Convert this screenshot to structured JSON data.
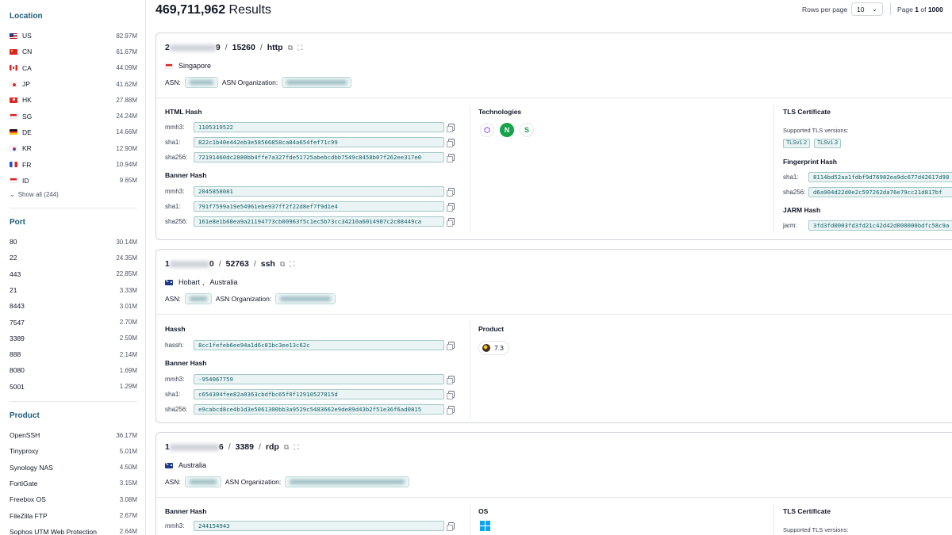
{
  "header": {
    "result_count": "469,711,962",
    "results_label": "Results",
    "rows_per_page_label": "Rows per page",
    "rows_per_page_value": "10",
    "page_label": "Page",
    "page_current": "1",
    "page_of": "of",
    "page_total": "1000"
  },
  "sidebar": {
    "location": {
      "title": "Location",
      "items": [
        {
          "name": "US",
          "count": "82.97M",
          "flag": "f-us"
        },
        {
          "name": "CN",
          "count": "61.67M",
          "flag": "f-cn"
        },
        {
          "name": "CA",
          "count": "44.09M",
          "flag": "f-ca"
        },
        {
          "name": "JP",
          "count": "41.62M",
          "flag": "f-jp"
        },
        {
          "name": "HK",
          "count": "27.88M",
          "flag": "f-hk"
        },
        {
          "name": "SG",
          "count": "24.24M",
          "flag": "f-sg"
        },
        {
          "name": "DE",
          "count": "14.66M",
          "flag": "f-de"
        },
        {
          "name": "KR",
          "count": "12.90M",
          "flag": "f-kr"
        },
        {
          "name": "FR",
          "count": "10.94M",
          "flag": "f-fr"
        },
        {
          "name": "ID",
          "count": "9.65M",
          "flag": "f-id"
        }
      ],
      "show_all": "Show all (244)"
    },
    "port": {
      "title": "Port",
      "items": [
        {
          "name": "80",
          "count": "30.14M"
        },
        {
          "name": "22",
          "count": "24.35M"
        },
        {
          "name": "443",
          "count": "22.85M"
        },
        {
          "name": "21",
          "count": "3.33M"
        },
        {
          "name": "8443",
          "count": "3.01M"
        },
        {
          "name": "7547",
          "count": "2.70M"
        },
        {
          "name": "3389",
          "count": "2.59M"
        },
        {
          "name": "888",
          "count": "2.14M"
        },
        {
          "name": "8080",
          "count": "1.69M"
        },
        {
          "name": "5001",
          "count": "1.29M"
        }
      ]
    },
    "product": {
      "title": "Product",
      "items": [
        {
          "name": "OpenSSH",
          "count": "36.17M"
        },
        {
          "name": "Tinyproxy",
          "count": "5.01M"
        },
        {
          "name": "Synology NAS",
          "count": "4.50M"
        },
        {
          "name": "FortiGate",
          "count": "3.15M"
        },
        {
          "name": "Freebox OS",
          "count": "3.08M"
        },
        {
          "name": "FileZilla FTP",
          "count": "2.67M"
        },
        {
          "name": "Sophos UTM Web Protection",
          "count": "2.64M"
        }
      ]
    }
  },
  "cards": [
    {
      "ip_first": "2",
      "ip_last": "9",
      "port": "15260",
      "protocol": "http",
      "location": "Singapore",
      "asn_label": "ASN:",
      "asn_org_label": "ASN Organization:",
      "html_hash": {
        "title": "HTML Hash",
        "mmh3_label": "mmh3:",
        "mmh3": "1105319522",
        "sha1_label": "sha1:",
        "sha1": "822c1b40e442eb3e58566858ca84a654fef71c99",
        "sha256_label": "sha256:",
        "sha256": "72191460dc2880bb4ffe7a327fde51725abebcdbb7549c8458b07f262ee317e0"
      },
      "banner_hash": {
        "title": "Banner Hash",
        "mmh3_label": "mmh3:",
        "mmh3": "2045858081",
        "sha1_label": "sha1:",
        "sha1": "791f7599a19e54961ebe937ff2f22d8ef7f9d1e4",
        "sha256_label": "sha256:",
        "sha256": "161e8e1b60ea9a21194773cb00963f5c1ec5b73cc34210a6014907c2c08449ca"
      },
      "technologies_title": "Technologies",
      "tls": {
        "title": "TLS Certificate",
        "versions_label": "Supported TLS versions:",
        "versions": [
          "TLSv1.2",
          "TLSv1.3"
        ],
        "fp_title": "Fingerprint Hash",
        "fp_sha1_label": "sha1:",
        "fp_sha1": "8114bd52aa1fdbf9d76982ea9dc677d42617d98",
        "fp_sha256_label": "sha256:",
        "fp_sha256": "d6a904d22d0e2c597262da76e79cc21d817bf",
        "jarm_title": "JARM Hash",
        "jarm_label": "jarm:",
        "jarm": "3fd3fd0003fd3fd21c42d42d000000bdfc58c9a"
      }
    },
    {
      "ip_first": "1",
      "ip_last": "0",
      "port": "52763",
      "protocol": "ssh",
      "city": "Hobart",
      "comma": ",",
      "location": "Australia",
      "asn_label": "ASN:",
      "asn_org_label": "ASN Organization:",
      "hassh": {
        "title": "Hassh",
        "label": "hassh:",
        "value": "8cc1fefeb6ee94a1d6c81bc3ee13c62c"
      },
      "banner_hash": {
        "title": "Banner Hash",
        "mmh3_label": "mmh3:",
        "mmh3": "-954067759",
        "sha1_label": "sha1:",
        "sha1": "c654304fee82a0363cbdfbc65f0f12910527815d",
        "sha256_label": "sha256:",
        "sha256": "e9cabcd8ce4b1d3e5061300bb3a9529c5483662e9de89d43b2f51e36f6ad0815"
      },
      "product_title": "Product",
      "product_version": "7.3"
    },
    {
      "ip_first": "1",
      "ip_last": "6",
      "port": "3389",
      "protocol": "rdp",
      "location": "Australia",
      "asn_label": "ASN:",
      "asn_org_label": "ASN Organization:",
      "banner_hash": {
        "title": "Banner Hash",
        "mmh3_label": "mmh3:",
        "mmh3": "244154943"
      },
      "os_title": "OS",
      "tls": {
        "title": "TLS Certificate",
        "versions_label": "Supported TLS versions:"
      }
    }
  ],
  "colors": {
    "accent": "#1e5c7a",
    "hash_bg": "#eaf4f4",
    "hash_border": "#a7c8c8",
    "hash_text": "#0f5f6a"
  }
}
